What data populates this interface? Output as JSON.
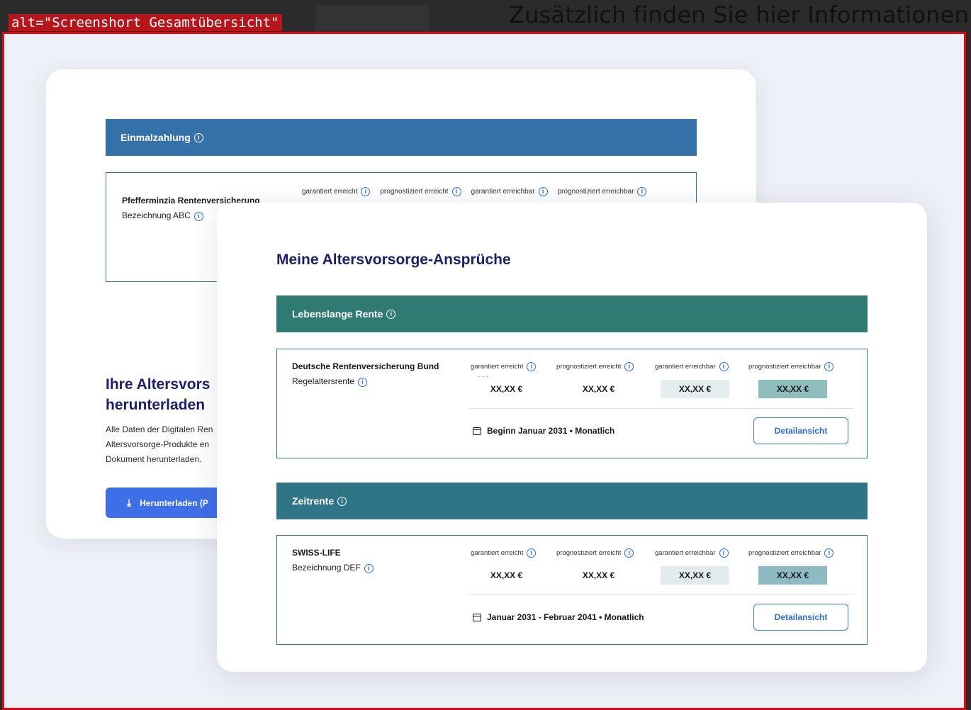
{
  "top": {
    "alt_text": "alt=\"Screenshort Gesamtübersicht\"",
    "headline": "Zusätzlich finden Sie hier Informationen übe"
  },
  "back_card": {
    "section_label": "Einmalzahlung",
    "product_name": "Pfefferminzia Rentenversicherung",
    "product_desc": "Bezeichnung ABC",
    "columns": [
      "garantiert erreicht",
      "prognostiziert erreicht",
      "garantiert erreichbar",
      "prognostiziert erreichbar"
    ],
    "heading_line1": "Ihre Altersvors",
    "heading_line2": "herunterladen",
    "paragraph_line1": "Alle Daten der Digitalen Ren",
    "paragraph_line2": "Altersvorsorge-Produkte en",
    "paragraph_line3": "Dokument herunterladen.",
    "download_label": "Herunterladen (P"
  },
  "front_card": {
    "title": "Meine Altersvorsorge-Ansprüche",
    "section1": {
      "label": "Lebenslange Rente",
      "product_name": "Deutsche Rentenversicherung Bund",
      "product_desc": "Regelaltersrente",
      "columns": [
        "garantiert erreicht",
        "prognostiziert erreicht",
        "garantiert erreichbar",
        "prognostiziert erreichbar"
      ],
      "values": [
        "XX,XX €",
        "XX,XX €",
        "XX,XX €",
        "XX,XX €"
      ],
      "date": "Beginn Januar 2031 • Monatlich",
      "button": "Detailansicht"
    },
    "section2": {
      "label": "Zeitrente",
      "product_name": "SWISS-LIFE",
      "product_desc": "Bezeichnung DEF",
      "columns": [
        "garantiert erreicht",
        "prognostiziert erreicht",
        "garantiert erreichbar",
        "prognostiziert erreichbar"
      ],
      "values": [
        "XX,XX €",
        "XX,XX €",
        "XX,XX €",
        "XX,XX €"
      ],
      "date": "Januar 2031 - Februar 2041 • Monatlich",
      "button": "Detailansicht"
    }
  },
  "colors": {
    "frame_border": "#e30613",
    "blue_band": "#3471a8",
    "green_band": "#2f7a72",
    "teal_band": "#2f7585",
    "primary_button": "#3f6fe6",
    "title_navy": "#1d1d6b"
  },
  "icons": {
    "info": "info-circle-icon",
    "calendar": "calendar-icon",
    "download": "download-icon"
  }
}
